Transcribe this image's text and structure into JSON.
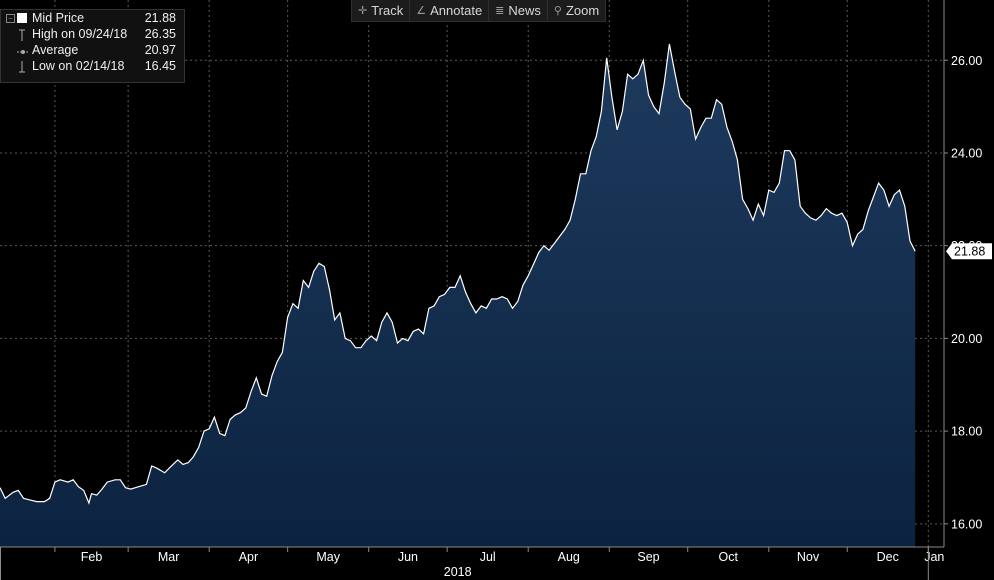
{
  "toolbar": {
    "items": [
      {
        "label": "Track",
        "icon": "crosshair-icon"
      },
      {
        "label": "Annotate",
        "icon": "pencil-icon"
      },
      {
        "label": "News",
        "icon": "news-icon"
      },
      {
        "label": "Zoom",
        "icon": "magnifier-icon"
      }
    ]
  },
  "legend": {
    "rows": [
      {
        "label": "Mid Price",
        "value": "21.88"
      },
      {
        "label": "High on 09/24/18",
        "value": "26.35"
      },
      {
        "label": "Average",
        "value": "20.97"
      },
      {
        "label": "Low on 02/14/18",
        "value": "16.45"
      }
    ]
  },
  "colors": {
    "background": "#000000",
    "area_top": "#1d3a5e",
    "area_bottom": "#0c2340",
    "line": "#ffffff",
    "grid": "#5a5a5a",
    "text": "#ffffff"
  },
  "chart_data": {
    "type": "area",
    "title": "",
    "xlabel": "2018",
    "ylabel": "",
    "ylim": [
      15.5,
      27.3
    ],
    "grid": true,
    "y_axis_side": "right",
    "y_ticks": [
      "16.00",
      "18.00",
      "20.00",
      "22.00",
      "24.00",
      "26.00"
    ],
    "y_tick_values": [
      16,
      18,
      20,
      22,
      24,
      26
    ],
    "x_ticks": [
      {
        "label": "Feb",
        "date": "2018-02-01"
      },
      {
        "label": "Mar",
        "date": "2018-03-01"
      },
      {
        "label": "Apr",
        "date": "2018-04-01"
      },
      {
        "label": "May",
        "date": "2018-05-01"
      },
      {
        "label": "Jun",
        "date": "2018-06-01"
      },
      {
        "label": "Jul",
        "date": "2018-07-01"
      },
      {
        "label": "Aug",
        "date": "2018-08-01"
      },
      {
        "label": "Sep",
        "date": "2018-09-01"
      },
      {
        "label": "Oct",
        "date": "2018-10-01"
      },
      {
        "label": "Nov",
        "date": "2018-11-01"
      },
      {
        "label": "Dec",
        "date": "2018-12-01"
      },
      {
        "label": "Jan",
        "date": "2019-01-01"
      }
    ],
    "x_range": [
      "2018-01-11",
      "2019-01-07"
    ],
    "last_value_label": "21.88",
    "series": [
      {
        "name": "Mid Price",
        "points": [
          [
            "2018-01-11",
            16.78
          ],
          [
            "2018-01-13",
            16.55
          ],
          [
            "2018-01-16",
            16.68
          ],
          [
            "2018-01-18",
            16.72
          ],
          [
            "2018-01-20",
            16.55
          ],
          [
            "2018-01-22",
            16.52
          ],
          [
            "2018-01-25",
            16.48
          ],
          [
            "2018-01-28",
            16.48
          ],
          [
            "2018-01-30",
            16.55
          ],
          [
            "2018-02-01",
            16.9
          ],
          [
            "2018-02-03",
            16.95
          ],
          [
            "2018-02-06",
            16.9
          ],
          [
            "2018-02-08",
            16.95
          ],
          [
            "2018-02-10",
            16.8
          ],
          [
            "2018-02-12",
            16.72
          ],
          [
            "2018-02-14",
            16.45
          ],
          [
            "2018-02-15",
            16.65
          ],
          [
            "2018-02-17",
            16.62
          ],
          [
            "2018-02-19",
            16.75
          ],
          [
            "2018-02-21",
            16.9
          ],
          [
            "2018-02-24",
            16.95
          ],
          [
            "2018-02-26",
            16.95
          ],
          [
            "2018-02-28",
            16.78
          ],
          [
            "2018-03-02",
            16.75
          ],
          [
            "2018-03-05",
            16.8
          ],
          [
            "2018-03-08",
            16.85
          ],
          [
            "2018-03-10",
            17.25
          ],
          [
            "2018-03-12",
            17.2
          ],
          [
            "2018-03-15",
            17.1
          ],
          [
            "2018-03-17",
            17.22
          ],
          [
            "2018-03-20",
            17.38
          ],
          [
            "2018-03-22",
            17.28
          ],
          [
            "2018-03-24",
            17.32
          ],
          [
            "2018-03-26",
            17.45
          ],
          [
            "2018-03-28",
            17.65
          ],
          [
            "2018-03-30",
            18
          ],
          [
            "2018-04-01",
            18.05
          ],
          [
            "2018-04-03",
            18.3
          ],
          [
            "2018-04-05",
            17.95
          ],
          [
            "2018-04-07",
            17.9
          ],
          [
            "2018-04-09",
            18.25
          ],
          [
            "2018-04-11",
            18.35
          ],
          [
            "2018-04-13",
            18.4
          ],
          [
            "2018-04-15",
            18.5
          ],
          [
            "2018-04-17",
            18.85
          ],
          [
            "2018-04-19",
            19.15
          ],
          [
            "2018-04-21",
            18.8
          ],
          [
            "2018-04-23",
            18.75
          ],
          [
            "2018-04-25",
            19.2
          ],
          [
            "2018-04-27",
            19.5
          ],
          [
            "2018-04-29",
            19.7
          ],
          [
            "2018-05-01",
            20.45
          ],
          [
            "2018-05-03",
            20.75
          ],
          [
            "2018-05-05",
            20.65
          ],
          [
            "2018-05-07",
            21.25
          ],
          [
            "2018-05-09",
            21.1
          ],
          [
            "2018-05-11",
            21.45
          ],
          [
            "2018-05-13",
            21.62
          ],
          [
            "2018-05-15",
            21.55
          ],
          [
            "2018-05-17",
            21.05
          ],
          [
            "2018-05-19",
            20.4
          ],
          [
            "2018-05-21",
            20.55
          ],
          [
            "2018-05-23",
            20.0
          ],
          [
            "2018-05-25",
            19.95
          ],
          [
            "2018-05-27",
            19.8
          ],
          [
            "2018-05-29",
            19.8
          ],
          [
            "2018-05-31",
            19.95
          ],
          [
            "2018-06-02",
            20.05
          ],
          [
            "2018-06-04",
            19.95
          ],
          [
            "2018-06-06",
            20.35
          ],
          [
            "2018-06-08",
            20.55
          ],
          [
            "2018-06-10",
            20.35
          ],
          [
            "2018-06-12",
            19.9
          ],
          [
            "2018-06-14",
            20.0
          ],
          [
            "2018-06-16",
            19.95
          ],
          [
            "2018-06-18",
            20.15
          ],
          [
            "2018-06-20",
            20.2
          ],
          [
            "2018-06-22",
            20.1
          ],
          [
            "2018-06-24",
            20.65
          ],
          [
            "2018-06-26",
            20.7
          ],
          [
            "2018-06-28",
            20.9
          ],
          [
            "2018-06-30",
            20.95
          ],
          [
            "2018-07-02",
            21.1
          ],
          [
            "2018-07-04",
            21.1
          ],
          [
            "2018-07-06",
            21.35
          ],
          [
            "2018-07-08",
            21.0
          ],
          [
            "2018-07-10",
            20.75
          ],
          [
            "2018-07-12",
            20.55
          ],
          [
            "2018-07-14",
            20.7
          ],
          [
            "2018-07-16",
            20.65
          ],
          [
            "2018-07-18",
            20.85
          ],
          [
            "2018-07-20",
            20.85
          ],
          [
            "2018-07-22",
            20.9
          ],
          [
            "2018-07-24",
            20.85
          ],
          [
            "2018-07-26",
            20.65
          ],
          [
            "2018-07-28",
            20.8
          ],
          [
            "2018-07-30",
            21.15
          ],
          [
            "2018-08-01",
            21.35
          ],
          [
            "2018-08-03",
            21.6
          ],
          [
            "2018-08-05",
            21.85
          ],
          [
            "2018-08-07",
            22.0
          ],
          [
            "2018-08-09",
            21.9
          ],
          [
            "2018-08-11",
            22.05
          ],
          [
            "2018-08-13",
            22.2
          ],
          [
            "2018-08-15",
            22.35
          ],
          [
            "2018-08-17",
            22.55
          ],
          [
            "2018-08-19",
            23.0
          ],
          [
            "2018-08-21",
            23.55
          ],
          [
            "2018-08-23",
            23.55
          ],
          [
            "2018-08-25",
            24.05
          ],
          [
            "2018-08-27",
            24.35
          ],
          [
            "2018-08-29",
            24.9
          ],
          [
            "2018-08-31",
            26.05
          ],
          [
            "2018-09-02",
            25.2
          ],
          [
            "2018-09-04",
            24.5
          ],
          [
            "2018-09-06",
            24.9
          ],
          [
            "2018-09-08",
            25.7
          ],
          [
            "2018-09-10",
            25.6
          ],
          [
            "2018-09-12",
            25.7
          ],
          [
            "2018-09-14",
            26.0
          ],
          [
            "2018-09-16",
            25.25
          ],
          [
            "2018-09-18",
            25.0
          ],
          [
            "2018-09-20",
            24.85
          ],
          [
            "2018-09-22",
            25.5
          ],
          [
            "2018-09-24",
            26.35
          ],
          [
            "2018-09-26",
            25.75
          ],
          [
            "2018-09-28",
            25.2
          ],
          [
            "2018-09-30",
            25.05
          ],
          [
            "2018-10-02",
            24.95
          ],
          [
            "2018-10-04",
            24.3
          ],
          [
            "2018-10-06",
            24.55
          ],
          [
            "2018-10-08",
            24.75
          ],
          [
            "2018-10-10",
            24.75
          ],
          [
            "2018-10-12",
            25.15
          ],
          [
            "2018-10-14",
            25.05
          ],
          [
            "2018-10-16",
            24.55
          ],
          [
            "2018-10-18",
            24.25
          ],
          [
            "2018-10-20",
            23.85
          ],
          [
            "2018-10-22",
            23.0
          ],
          [
            "2018-10-24",
            22.8
          ],
          [
            "2018-10-26",
            22.55
          ],
          [
            "2018-10-28",
            22.9
          ],
          [
            "2018-10-30",
            22.65
          ],
          [
            "2018-11-01",
            23.2
          ],
          [
            "2018-11-03",
            23.15
          ],
          [
            "2018-11-05",
            23.35
          ],
          [
            "2018-11-07",
            24.05
          ],
          [
            "2018-11-09",
            24.05
          ],
          [
            "2018-11-11",
            23.85
          ],
          [
            "2018-11-13",
            22.85
          ],
          [
            "2018-11-15",
            22.7
          ],
          [
            "2018-11-17",
            22.6
          ],
          [
            "2018-11-19",
            22.55
          ],
          [
            "2018-11-21",
            22.65
          ],
          [
            "2018-11-23",
            22.8
          ],
          [
            "2018-11-25",
            22.7
          ],
          [
            "2018-11-27",
            22.65
          ],
          [
            "2018-11-29",
            22.7
          ],
          [
            "2018-12-01",
            22.5
          ],
          [
            "2018-12-03",
            22.0
          ],
          [
            "2018-12-05",
            22.25
          ],
          [
            "2018-12-07",
            22.35
          ],
          [
            "2018-12-09",
            22.75
          ],
          [
            "2018-12-11",
            23.05
          ],
          [
            "2018-12-13",
            23.35
          ],
          [
            "2018-12-15",
            23.2
          ],
          [
            "2018-12-17",
            22.85
          ],
          [
            "2018-12-19",
            23.1
          ],
          [
            "2018-12-21",
            23.2
          ],
          [
            "2018-12-23",
            22.85
          ],
          [
            "2018-12-25",
            22.1
          ],
          [
            "2018-12-27",
            21.88
          ]
        ]
      }
    ]
  }
}
